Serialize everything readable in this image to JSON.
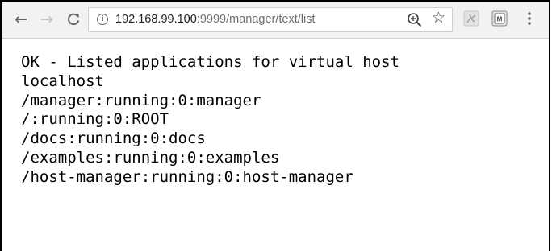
{
  "toolbar": {
    "back_icon": "←",
    "forward_icon": "→",
    "reload_icon": "C",
    "info_icon": "i",
    "star_icon": "☆",
    "url_host": "192.168.99.100",
    "url_rest": ":9999/manager/text/list"
  },
  "page": {
    "lines": [
      "OK - Listed applications for virtual host",
      "localhost",
      "/manager:running:0:manager",
      "/:running:0:ROOT",
      "/docs:running:0:docs",
      "/examples:running:0:examples",
      "/host-manager:running:0:host-manager"
    ]
  },
  "colors": {
    "toolbar_bg": "#f2f2f2",
    "icon": "#5f6368",
    "url_secondary": "#6e6e6e",
    "text": "#000000"
  }
}
